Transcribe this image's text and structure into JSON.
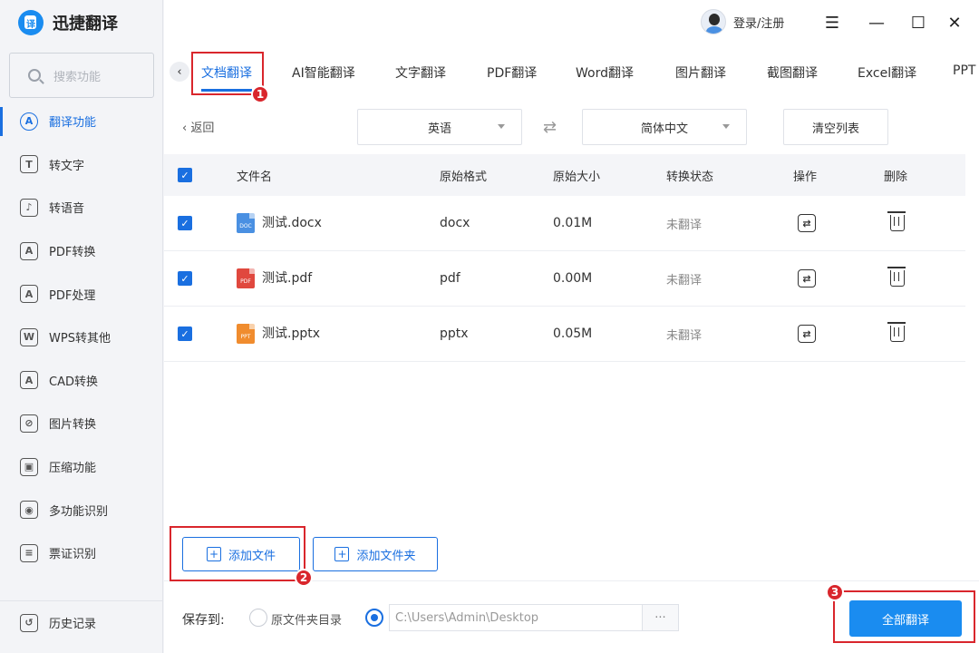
{
  "app": {
    "title": "迅捷翻译",
    "logo_glyph": "译"
  },
  "search": {
    "placeholder": "搜索功能"
  },
  "sidebar": {
    "items": [
      {
        "label": "翻译功能",
        "icon": "translate-icon",
        "glyph": "A"
      },
      {
        "label": "转文字",
        "icon": "text-convert-icon",
        "glyph": "T"
      },
      {
        "label": "转语音",
        "icon": "voice-icon",
        "glyph": "♪"
      },
      {
        "label": "PDF转换",
        "icon": "pdf-convert-icon",
        "glyph": "A"
      },
      {
        "label": "PDF处理",
        "icon": "pdf-process-icon",
        "glyph": "A"
      },
      {
        "label": "WPS转其他",
        "icon": "wps-icon",
        "glyph": "W"
      },
      {
        "label": "CAD转换",
        "icon": "cad-icon",
        "glyph": "A"
      },
      {
        "label": "图片转换",
        "icon": "image-convert-icon",
        "glyph": "⊘"
      },
      {
        "label": "压缩功能",
        "icon": "compress-icon",
        "glyph": "▣"
      },
      {
        "label": "多功能识别",
        "icon": "eye-icon",
        "glyph": "◉"
      },
      {
        "label": "票证识别",
        "icon": "ticket-icon",
        "glyph": "≡"
      }
    ],
    "history": {
      "label": "历史记录",
      "icon": "history-icon",
      "glyph": "↺"
    }
  },
  "header": {
    "login_label": "登录/注册",
    "menu_glyph": "☰",
    "minimize_glyph": "—",
    "maximize_glyph": "☐",
    "close_glyph": "✕"
  },
  "tabs": {
    "back_glyph": "‹",
    "items": [
      {
        "label": "文档翻译"
      },
      {
        "label": "AI智能翻译"
      },
      {
        "label": "文字翻译"
      },
      {
        "label": "PDF翻译"
      },
      {
        "label": "Word翻译"
      },
      {
        "label": "图片翻译"
      },
      {
        "label": "截图翻译"
      },
      {
        "label": "Excel翻译"
      },
      {
        "label": "PPT"
      }
    ]
  },
  "annotations": {
    "step1": "1",
    "step2": "2",
    "step3": "3"
  },
  "toolbar": {
    "back_label": "‹  返回",
    "source_lang": "英语",
    "swap_glyph": "⇄",
    "target_lang": "简体中文",
    "clear_label": "清空列表"
  },
  "table": {
    "columns": [
      "文件名",
      "原始格式",
      "原始大小",
      "转换状态",
      "操作",
      "删除"
    ],
    "rows": [
      {
        "name": "测试.docx",
        "format": "docx",
        "size": "0.01M",
        "status": "未翻译",
        "type": "DOC",
        "color": "#4a90e2"
      },
      {
        "name": "测试.pdf",
        "format": "pdf",
        "size": "0.00M",
        "status": "未翻译",
        "type": "PDF",
        "color": "#e0483e"
      },
      {
        "name": "测试.pptx",
        "format": "pptx",
        "size": "0.05M",
        "status": "未翻译",
        "type": "PPT",
        "color": "#f08c2e"
      }
    ]
  },
  "actions": {
    "add_file_label": "添加文件",
    "add_folder_label": "添加文件夹",
    "plus_glyph": "+"
  },
  "footer": {
    "save_label": "保存到:",
    "original_dir_label": "原文件夹目录",
    "path_value": "C:\\Users\\Admin\\Desktop",
    "browse_label": "···",
    "translate_all_label": "全部翻译"
  },
  "colors": {
    "accent": "#1a6fe0",
    "primary_button": "#1a8cf0",
    "annotation_red": "#d9262c"
  }
}
